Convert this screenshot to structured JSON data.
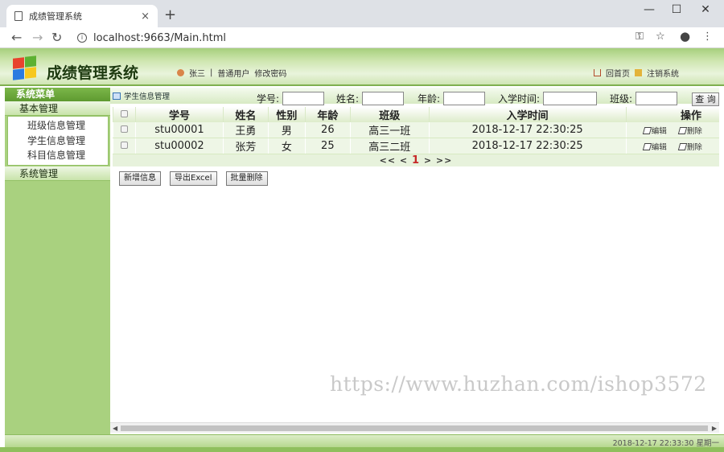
{
  "browser": {
    "tab_title": "成绩管理系统",
    "tab_close": "×",
    "new_tab": "+",
    "url": "localhost:9663/Main.html",
    "win_min": "—",
    "win_max": "☐",
    "win_close": "✕"
  },
  "header": {
    "title": "成绩管理系统",
    "user": "张三",
    "sep": "|",
    "role": "普通用户",
    "change_pwd": "修改密码",
    "home": "回首页",
    "logout": "注销系统"
  },
  "sidebar": {
    "title": "系统菜单",
    "groups": [
      {
        "label": "基本管理",
        "items": [
          "班级信息管理",
          "学生信息管理",
          "科目信息管理"
        ]
      },
      {
        "label": "系统管理"
      }
    ]
  },
  "content": {
    "breadcrumb": "学生信息管理",
    "search": {
      "student_no": "学号:",
      "name": "姓名:",
      "age": "年龄:",
      "enroll_time": "入学时间:",
      "class": "班级:",
      "button": "查 询"
    },
    "columns": [
      "学号",
      "姓名",
      "性别",
      "年龄",
      "班级",
      "入学时间",
      "操作"
    ],
    "rows": [
      {
        "no": "stu00001",
        "name": "王勇",
        "gender": "男",
        "age": "26",
        "class": "高三一班",
        "time": "2018-12-17 22:30:25"
      },
      {
        "no": "stu00002",
        "name": "张芳",
        "gender": "女",
        "age": "25",
        "class": "高三二班",
        "time": "2018-12-17 22:30:25"
      }
    ],
    "ops": {
      "edit": "编辑",
      "delete": "删除"
    },
    "pager": {
      "first": "<<",
      "prev": "<",
      "current": "1",
      "next": ">",
      "last": ">>"
    },
    "actions": {
      "add": "新增信息",
      "export": "导出Excel",
      "batch_delete": "批量删除"
    }
  },
  "watermark": "https://www.huzhan.com/ishop3572",
  "status": {
    "clock": "2018-12-17 22:33:30 星期一"
  },
  "colors": {
    "accent_green": "#7cb74a",
    "pager_current": "#c62828"
  }
}
